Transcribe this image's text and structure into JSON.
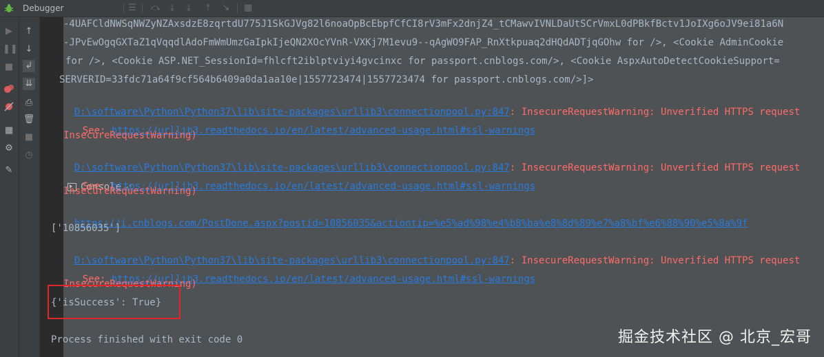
{
  "tabs": {
    "debugger_label": "Debugger",
    "console_label": "Console",
    "console_pin": "→*"
  },
  "icons": {
    "app": "bug-icon",
    "toolbar": [
      "menu-icon",
      "step-over-icon",
      "step-into-icon",
      "step-into-my-code-icon",
      "step-out-icon",
      "run-to-cursor-icon",
      "evaluate-icon"
    ],
    "left_column_1": [
      "resume-icon",
      "pause-icon",
      "stop-icon",
      "view-breakpoints-icon",
      "mute-breakpoints-icon",
      "layout-icon",
      "settings-icon",
      "pin-icon"
    ],
    "left_column_2": [
      "up-arrow-icon",
      "down-arrow-icon",
      "soft-wrap-icon",
      "scroll-to-end-icon",
      "print-icon",
      "trash-icon",
      "stop-square-icon",
      "clock-icon"
    ]
  },
  "console": {
    "line1": "-4UAFCldNWSqNWZyNZAxsdzE8zqrtdU775J1SkGJVg82l6noaOpBcEbpfCfCI8rV3mFx2dnjZ4_tCMawvIVNLDaUtSCrVmxL0dPBkfBctv1JoIXg6oJV9ei81a6N",
    "line2": "-JPvEwOgqGXTaZ1qVqqdlAdoFmWmUmzGaIpkIjeQN2XOcYVnR-VXKj7M1evu9--qAgWO9FAP_RnXtkpuaq2dHQdADTjqGOhw for />, <Cookie AdminCookie",
    "line3": "for />, <Cookie ASP.NET_SessionId=fhlcft2iblptviyi4gvcinxc for passport.cnblogs.com/>, <Cookie AspxAutoDetectCookieSupport=",
    "line4": "SERVERID=33fdc71a64f9cf564b6409a0da1aa10e|1557723474|1557723474 for passport.cnblogs.com/>]>",
    "warn_path": "D:\\software\\Python\\Python37\\lib\\site-packages\\urllib3\\connectionpool.py:847",
    "warn_text": ": InsecureRequestWarning: Unverified HTTPS request",
    "see_label": "See: ",
    "see_link": "https://urllib3.readthedocs.io/en/latest/advanced-usage.html#ssl-warnings",
    "warn_end": "InsecureRequestWarning)",
    "post_link": "https://i.cnblogs.com/PostDone.aspx?postid=10856035&actiontip=%e5%ad%98%e4%b8%ba%e8%8d%89%e7%a8%bf%e6%88%90%e5%8a%9f",
    "post_id": "['10856035']",
    "result": "{'isSuccess': True}",
    "finished": "Process finished with exit code 0"
  },
  "watermark": "掘金技术社区 @ 北京_宏哥",
  "colors": {
    "background": "#2b2b2b",
    "panel": "#3c3f41",
    "text": "#a9b7c6",
    "error": "#ff6b68",
    "link": "#287bde",
    "highlight_box": "#e0262a"
  }
}
